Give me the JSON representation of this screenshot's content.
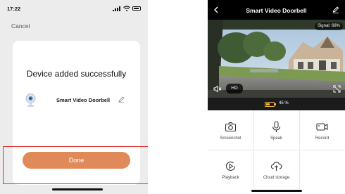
{
  "left_screen": {
    "status_time": "17:22",
    "cancel_label": "Cancel",
    "title": "Device added successfully",
    "device_name": "Smart Video Doorbell",
    "done_label": "Done"
  },
  "right_screen": {
    "title": "Smart Video Doorbell",
    "signal_text": "Signal: 68%",
    "hd_label": "HD",
    "battery_text": "45 %",
    "battery_level": 0.45,
    "controls": [
      {
        "label": "Screenshot",
        "icon": "camera-icon"
      },
      {
        "label": "Speak",
        "icon": "microphone-icon"
      },
      {
        "label": "Record",
        "icon": "video-record-icon"
      },
      {
        "label": "Playback",
        "icon": "playback-icon"
      },
      {
        "label": "Cloud storage",
        "icon": "cloud-upload-icon"
      }
    ]
  },
  "colors": {
    "done_button": "#e08a5a",
    "highlight_border": "#e22b2b",
    "nav_bar": "#000000",
    "battery_accent": "#f0b43c"
  }
}
